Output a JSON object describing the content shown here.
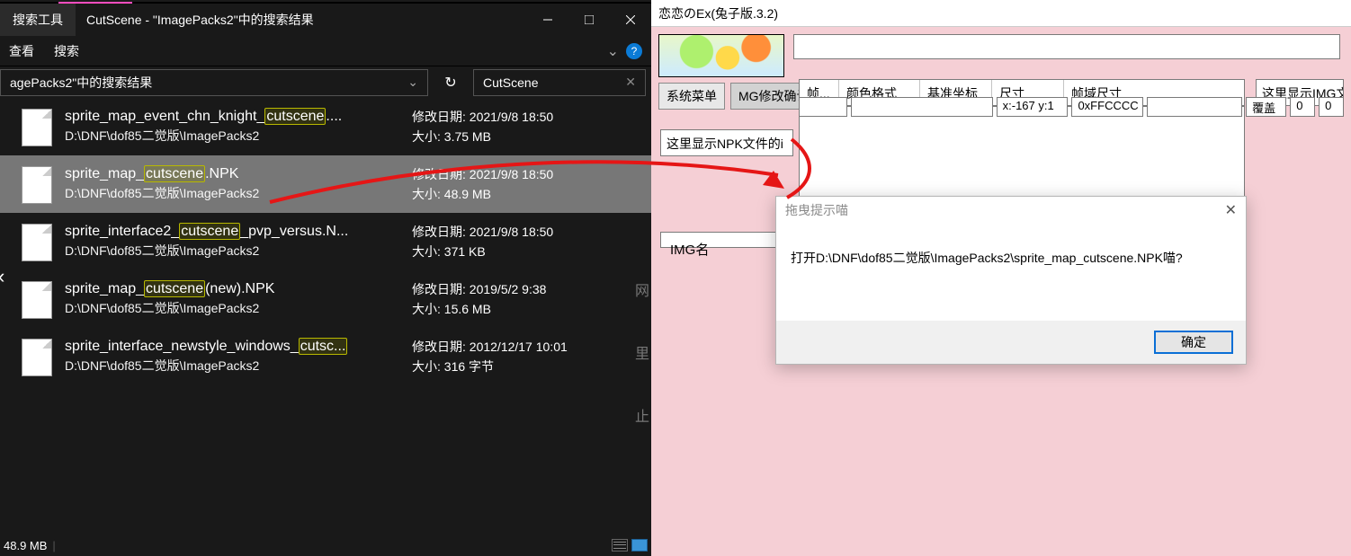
{
  "explorer": {
    "tab_label": "搜索工具",
    "title": "CutScene - \"ImagePacks2\"中的搜索结果",
    "menu": {
      "view": "查看",
      "search": "搜索"
    },
    "breadcrumb": "agePacks2\"中的搜索结果",
    "search_value": "CutScene",
    "meta_labels": {
      "date": "修改日期:",
      "size": "大小:"
    },
    "files": [
      {
        "pre": "sprite_map_event_chn_knight_",
        "hl": "cutscene",
        "post": "....",
        "path": "D:\\DNF\\dof85二觉版\\ImagePacks2",
        "date": "2021/9/8 18:50",
        "size": "3.75 MB"
      },
      {
        "pre": "sprite_map_",
        "hl": "cutscene",
        "post": ".NPK",
        "path": "D:\\DNF\\dof85二觉版\\ImagePacks2",
        "date": "2021/9/8 18:50",
        "size": "48.9 MB"
      },
      {
        "pre": "sprite_interface2_",
        "hl": "cutscene",
        "post": "_pvp_versus.N...",
        "path": "D:\\DNF\\dof85二觉版\\ImagePacks2",
        "date": "2021/9/8 18:50",
        "size": "371 KB"
      },
      {
        "pre": "sprite_map_",
        "hl": "cutscene",
        "post": "(new).NPK",
        "path": "D:\\DNF\\dof85二觉版\\ImagePacks2",
        "date": "2019/5/2 9:38",
        "size": "15.6 MB"
      },
      {
        "pre": "sprite_interface_newstyle_windows_",
        "hl": "cutsc...",
        "post": "",
        "path": "D:\\DNF\\dof85二觉版\\ImagePacks2",
        "date": "2012/12/17 10:01",
        "size": "316 字节"
      }
    ],
    "status": "48.9 MB"
  },
  "side_glyphs": [
    "网",
    "里",
    "止"
  ],
  "extool": {
    "title": "恋恋のEx(兔子版.3.2)",
    "buttons": {
      "sys_menu": "系统菜单",
      "mg_confirm": "MG修改确认"
    },
    "grid_headers": [
      "帧...",
      "颜色格式",
      "基准坐标",
      "尺寸",
      "帧域尺寸"
    ],
    "right_box": "这里显示IMG文",
    "npk_hint": "这里显示NPK文件的i",
    "img_panel_label": "IMG名",
    "bottom": {
      "coord": "x:-167 y:1",
      "color": "0xFFCCCC",
      "cover": "覆盖",
      "zero_a": "0",
      "zero_b": "0"
    }
  },
  "dialog": {
    "title": "拖曳提示喵",
    "body": "打开D:\\DNF\\dof85二觉版\\ImagePacks2\\sprite_map_cutscene.NPK喵?",
    "ok": "确定"
  }
}
